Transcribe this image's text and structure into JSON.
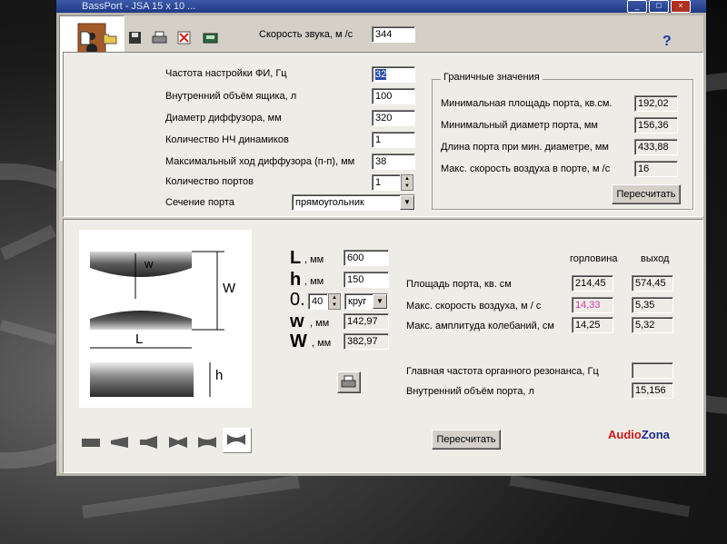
{
  "window": {
    "title": "BassPort - JSA 15 x 10 ...",
    "sound_speed_label": "Скорость звука, м /с",
    "sound_speed_value": "344",
    "help_label": "?"
  },
  "toolbar": [
    "new-icon",
    "open-icon",
    "save-icon",
    "print-icon",
    "delete-icon",
    "export-icon"
  ],
  "params": {
    "tuning_freq_label": "Частота настройки ФИ, Гц",
    "tuning_freq_value": "32",
    "box_volume_label": "Внутренний объём ящика, л",
    "box_volume_value": "100",
    "cone_diameter_label": "Диаметр диффузора, мм",
    "cone_diameter_value": "320",
    "drivers_count_label": "Количество НЧ динамиков",
    "drivers_count_value": "1",
    "max_excursion_label": "Максимальный ход диффузора (п-п), мм",
    "max_excursion_value": "38",
    "ports_count_label": "Количество портов",
    "ports_count_value": "1",
    "port_section_label": "Сечение порта",
    "port_section_value": "прямоугольник"
  },
  "limits": {
    "title": "Граничные значения",
    "min_area_label": "Минимальная площадь порта, кв.см.",
    "min_area_value": "192,02",
    "min_diameter_label": "Минимальный диаметр порта, мм",
    "min_diameter_value": "156,36",
    "port_length_label": "Длина порта при мин. диаметре, мм",
    "port_length_value": "433,88",
    "max_air_speed_label": "Макс. скорость воздуха в порте, м /с",
    "max_air_speed_value": "16",
    "recalc_label": "Пересчитать"
  },
  "diagram": {
    "w_small": "w",
    "w_big": "W",
    "l_label": "L",
    "h_label": "h"
  },
  "dims": {
    "L_sym": "L",
    "L_unit": ", мм",
    "L_value": "600",
    "h_sym": "h",
    "h_unit": ", мм",
    "h_value": "150",
    "o_sym": "0.",
    "o_value": "40",
    "o_shape": "круг",
    "w_sym": "w",
    "w_unit": ", мм",
    "w_value": "142,97",
    "W_sym": "W",
    "W_unit": ", мм",
    "W_value": "382,97"
  },
  "results": {
    "col_throat": "горловина",
    "col_exit": "выход",
    "area_label": "Площадь порта, кв. см",
    "area_throat": "214,45",
    "area_exit": "574,45",
    "speed_label": "Макс. скорость воздуха, м / с",
    "speed_throat": "14,33",
    "speed_exit": "5,35",
    "amplitude_label": "Макс. амплитуда колебаний, см",
    "amplitude_throat": "14,25",
    "amplitude_exit": "5,32",
    "organ_label": "Главная частота органного резонанса, Гц",
    "organ_value": "",
    "port_volume_label": "Внутренний объём порта, л",
    "port_volume_value": "15,156",
    "recalc_label": "Пересчитать"
  },
  "brand": {
    "part1": "Audio",
    "part2": "Zona",
    "color1": "#cc1a1a",
    "color2": "#1a2a8a"
  },
  "colors": {
    "speed_highlight": "#d03aa8",
    "selection": "#2a4aa8"
  }
}
